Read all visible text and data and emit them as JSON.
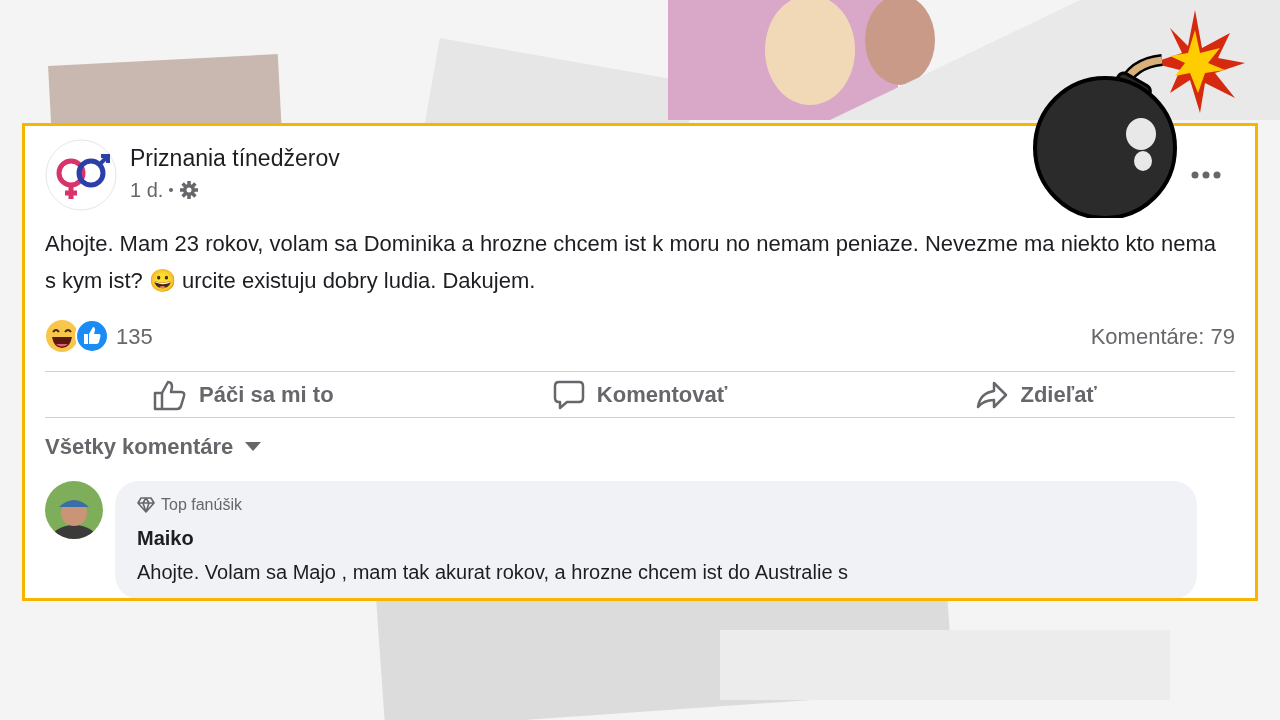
{
  "post": {
    "page_name": "Priznania tínedžerov",
    "time": "1 d.",
    "text": "Ahojte. Mam 23 rokov, volam sa Dominika a hrozne chcem ist k moru no nemam peniaze. Nevezme ma niekto kto nema s kym ist? 😀 urcite existuju dobry ludia. Dakujem.",
    "reaction_count": "135",
    "comment_count": "Komentáre: 79"
  },
  "actions": [
    {
      "kind": "like",
      "label": "Páči sa mi to"
    },
    {
      "kind": "comment",
      "label": "Komentovať"
    },
    {
      "kind": "share",
      "label": "Zdieľať"
    }
  ],
  "comment_filter": "Všetky komentáre",
  "comments": [
    {
      "badge": "Top fanúšik",
      "author": "Maiko",
      "text": "Ahojte. Volam sa Majo , mam tak akurat rokov, a hrozne chcem ist do Australie s"
    }
  ]
}
